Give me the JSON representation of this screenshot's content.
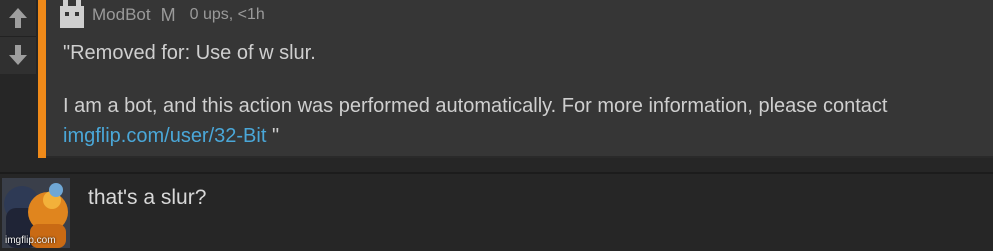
{
  "comment": {
    "username": "ModBot",
    "mod_badge": "M",
    "meta": "0 ups, <1h",
    "line1": "\"Removed for: Use of w slur.",
    "line2": "I am a bot, and this action was performed automatically. For more information, please contact",
    "link": "imgflip.com/user/32-Bit",
    "closing_quote": " \"",
    "accent_color": "#f08a19",
    "link_color": "#4aa7d8"
  },
  "vote": {
    "up_icon": "arrow-up-icon",
    "down_icon": "arrow-down-icon"
  },
  "reply": {
    "text": "that's a slur?",
    "avatar_icon": "user-avatar"
  },
  "watermark": "imgflip.com"
}
